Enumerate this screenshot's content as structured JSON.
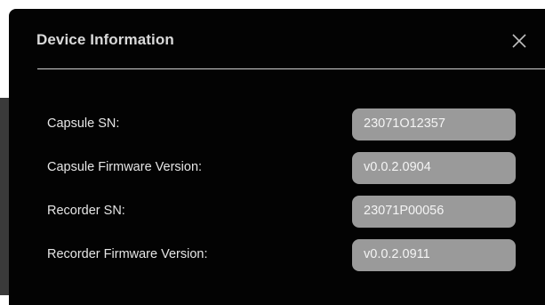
{
  "dialog": {
    "title": "Device Information",
    "close_icon": "close-icon"
  },
  "fields": [
    {
      "label": "Capsule SN:",
      "value": "23071O12357"
    },
    {
      "label": "Capsule Firmware Version:",
      "value": "v0.0.2.0904"
    },
    {
      "label": "Recorder SN:",
      "value": "23071P00056"
    },
    {
      "label": "Recorder Firmware Version:",
      "value": "v0.0.2.0911"
    }
  ],
  "colors": {
    "dialog_background": "#030303",
    "field_background": "#9a9a9a",
    "text": "#e6e6e6"
  }
}
